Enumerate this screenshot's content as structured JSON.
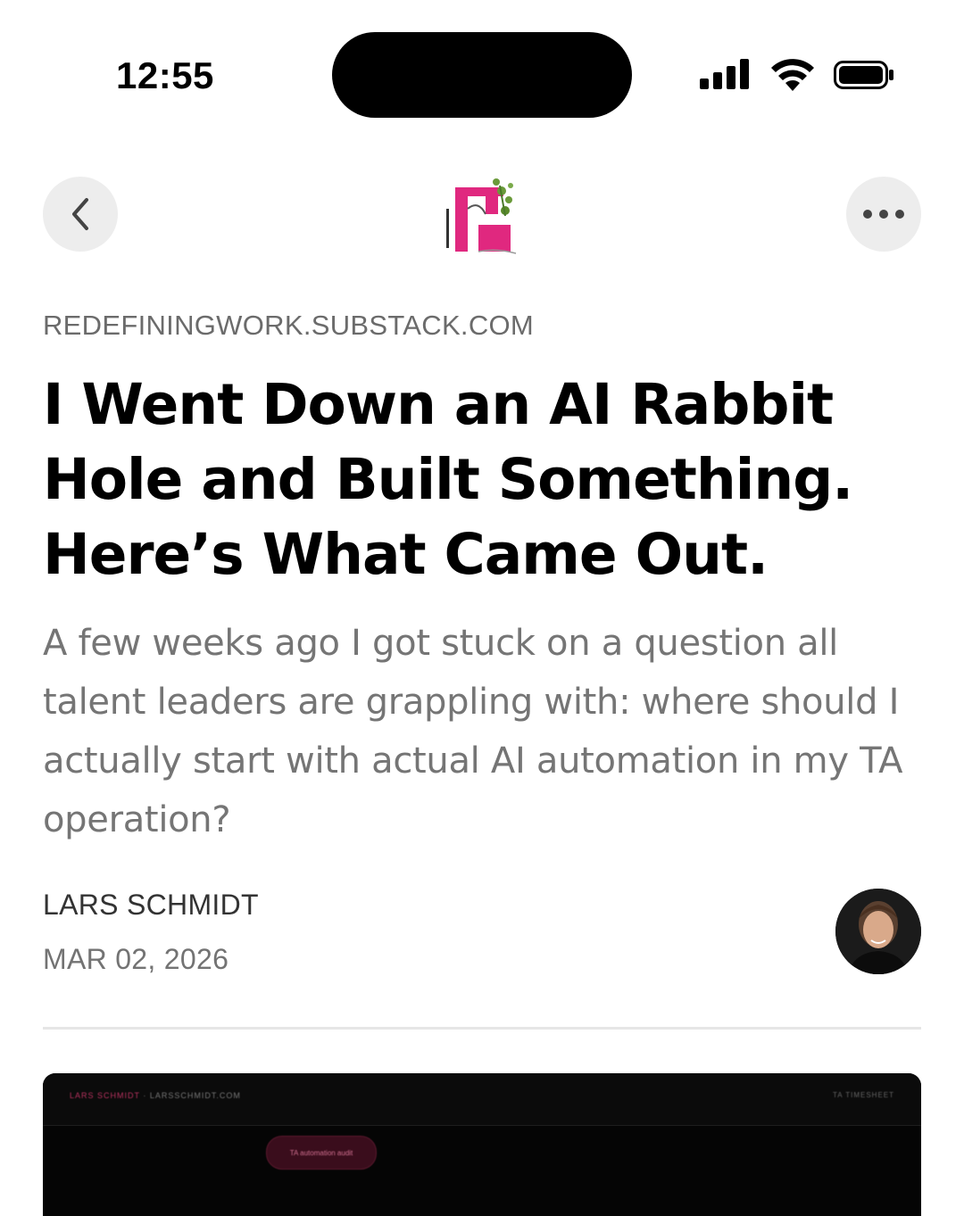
{
  "status_bar": {
    "time": "12:55",
    "icons": [
      "signal-icon",
      "wifi-icon",
      "battery-icon"
    ]
  },
  "nav": {
    "back_icon": "chevron-left-icon",
    "more_icon": "ellipsis-icon",
    "logo_icon": "publication-logo"
  },
  "article": {
    "domain": "REDEFININGWORK.SUBSTACK.COM",
    "title": "I Went Down an AI Rabbit Hole and Built Something. Here’s What Came Out.",
    "subtitle": "A few weeks ago I got stuck on a question all talent leaders are grappling with: where should I actually start with actual AI automation in my TA operation?",
    "author": "LARS SCHMIDT",
    "date": "MAR 02, 2026"
  },
  "hero": {
    "brand_name": "LARS SCHMIDT",
    "brand_site": "LARSSCHMIDT.COM",
    "nav_text": "TA TIMESHEET",
    "pill_label": "TA automation audit"
  },
  "colors": {
    "accent": "#e0287f",
    "text_primary": "#000000",
    "text_secondary": "#757575",
    "nav_button_bg": "#ededed",
    "divider": "#e6e6e6"
  }
}
